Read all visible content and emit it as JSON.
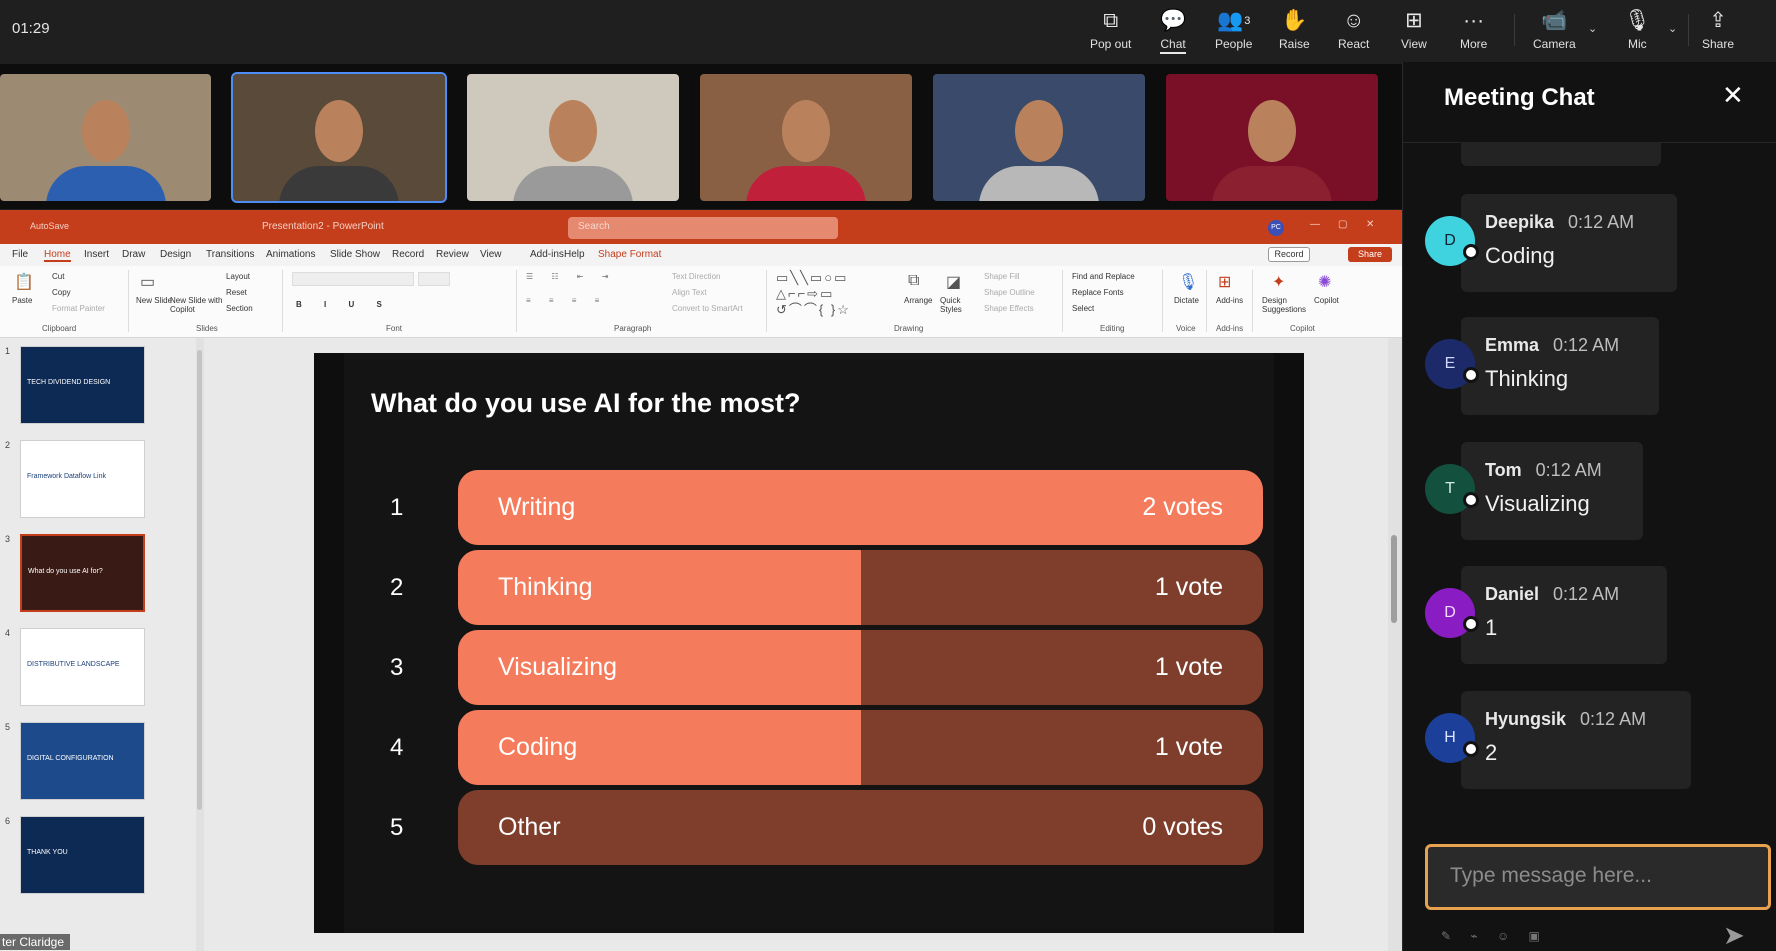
{
  "clock": "01:29",
  "toolbar": {
    "pop_out": "Pop out",
    "chat": "Chat",
    "people": "People",
    "people_count": "3",
    "raise": "Raise",
    "react": "React",
    "view": "View",
    "more": "More",
    "camera": "Camera",
    "mic": "Mic",
    "share": "Share"
  },
  "participants": [
    {
      "shirt": "#2c5fb0",
      "bg": "#9c8a72"
    },
    {
      "shirt": "#3a3a3a",
      "bg": "#5a4a3a"
    },
    {
      "shirt": "#9a9a9a",
      "bg": "#cfc9bd"
    },
    {
      "shirt": "#c0203a",
      "bg": "#8a6044"
    },
    {
      "shirt": "#b8b8b8",
      "bg": "#3a4a6a"
    },
    {
      "shirt": "#8a2030",
      "bg": "#7a1028"
    }
  ],
  "powerpoint": {
    "autosave": "AutoSave",
    "filename": "Presentation2 - PowerPoint",
    "search": "Search",
    "user_initials": "PC",
    "tabs": [
      "File",
      "Home",
      "Insert",
      "Draw",
      "Design",
      "Transitions",
      "Animations",
      "Slide Show",
      "Record",
      "Review",
      "View",
      "Add-ins",
      "Help",
      "Shape Format"
    ],
    "record": "Record",
    "share": "Share",
    "ribbon_groups": [
      "Clipboard",
      "Slides",
      "Font",
      "Paragraph",
      "Drawing",
      "Editing",
      "Voice",
      "Add-ins",
      "Copilot"
    ],
    "ribbon_items": {
      "paste": "Paste",
      "cut": "Cut",
      "copy": "Copy",
      "format_painter": "Format Painter",
      "new_slide": "New Slide",
      "new_slide_copilot": "New Slide with Copilot",
      "layout": "Layout",
      "reset": "Reset",
      "section": "Section",
      "text_direction": "Text Direction",
      "align_text": "Align Text",
      "convert_smartart": "Convert to SmartArt",
      "arrange": "Arrange",
      "quick_styles": "Quick Styles",
      "shape_fill": "Shape Fill",
      "shape_outline": "Shape Outline",
      "shape_effects": "Shape Effects",
      "find_replace": "Find and Replace",
      "replace_fonts": "Replace Fonts",
      "select": "Select",
      "dictate": "Dictate",
      "add_ins": "Add-ins",
      "design_suggestions": "Design Suggestions",
      "copilot": "Copilot"
    },
    "thumbs": [
      {
        "num": "1",
        "caption": "TECH DIVIDEND DESIGN"
      },
      {
        "num": "2",
        "caption": "Framework  Dataflow  Link"
      },
      {
        "num": "3",
        "caption": "What do you use AI for?"
      },
      {
        "num": "4",
        "caption": "DISTRIBUTIVE LANDSCAPE"
      },
      {
        "num": "5",
        "caption": "DIGITAL CONFIGURATION"
      },
      {
        "num": "6",
        "caption": "THANK YOU"
      }
    ]
  },
  "slide": {
    "question": "What do you use AI for the most?",
    "options": [
      {
        "num": "1",
        "label": "Writing",
        "votes": "2 votes",
        "share": 1.0
      },
      {
        "num": "2",
        "label": "Thinking",
        "votes": "1 vote",
        "share": 0.5
      },
      {
        "num": "3",
        "label": "Visualizing",
        "votes": "1 vote",
        "share": 0.5
      },
      {
        "num": "4",
        "label": "Coding",
        "votes": "1 vote",
        "share": 0.5
      },
      {
        "num": "5",
        "label": "Other",
        "votes": "0 votes",
        "share": 0.0
      }
    ],
    "colors": {
      "fill": "#f47c5c",
      "track": "#7f3e2c"
    }
  },
  "presenter_name": "ter Claridge",
  "chat": {
    "title": "Meeting Chat",
    "messages": [
      {
        "initial": "D",
        "name": "Deepika",
        "time": "0:12 AM",
        "text": "Coding",
        "color": "#3fd3e0",
        "textcolor": "#123"
      },
      {
        "initial": "E",
        "name": "Emma",
        "time": "0:12 AM",
        "text": "Thinking",
        "color": "#1c2a6a",
        "textcolor": "#cfd6ff"
      },
      {
        "initial": "T",
        "name": "Tom",
        "time": "0:12 AM",
        "text": "Visualizing",
        "color": "#13503e",
        "textcolor": "#cfeee2"
      },
      {
        "initial": "D",
        "name": "Daniel",
        "time": "0:12 AM",
        "text": "1",
        "color": "#8a1cc4",
        "textcolor": "#f3dcff"
      },
      {
        "initial": "H",
        "name": "Hyungsik",
        "time": "0:12 AM",
        "text": "2",
        "color": "#1c3f9a",
        "textcolor": "#dbe5ff"
      }
    ],
    "input_placeholder": "Type message here..."
  }
}
